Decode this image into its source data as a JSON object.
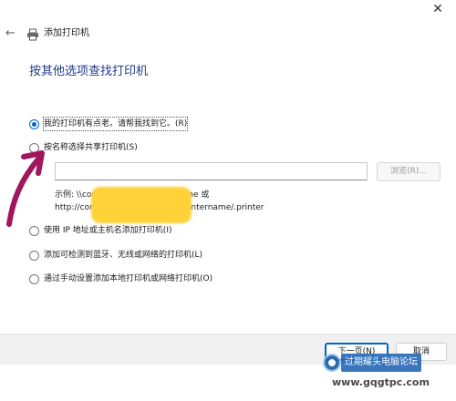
{
  "window": {
    "close_glyph": "✕"
  },
  "header": {
    "back_icon": "back-arrow-icon",
    "printer_icon": "printer-icon",
    "title": "添加打印机"
  },
  "main": {
    "heading": "按其他选项查找打印机",
    "options": [
      {
        "label": "我的打印机有点老。请帮我找到它。(R)",
        "checked": true
      },
      {
        "label": "按名称选择共享打印机(S)",
        "checked": false
      },
      {
        "label": "使用 IP 地址或主机名添加打印机(I)",
        "checked": false
      },
      {
        "label": "添加可检测到蓝牙、无线或网络的打印机(L)",
        "checked": false
      },
      {
        "label": "通过手动设置添加本地打印机或网络打印机(O)",
        "checked": false
      }
    ],
    "share_input": {
      "value": "",
      "placeholder": ""
    },
    "browse_label": "浏览(R)...",
    "example_line1": "示例: \\\\computername\\printername 或",
    "example_line2": "http://computername/printers/printername/.printer"
  },
  "footer": {
    "next_label": "下一页(N)",
    "cancel_label": "取消"
  },
  "watermark": {
    "line1": "过期耀头电脑论坛",
    "line2": "www.gqgtpc.com"
  },
  "colors": {
    "accent": "#0067c0",
    "heading": "#1f3a8a",
    "annotation_arrow": "#a0175e",
    "redaction": "#ffd23a"
  }
}
